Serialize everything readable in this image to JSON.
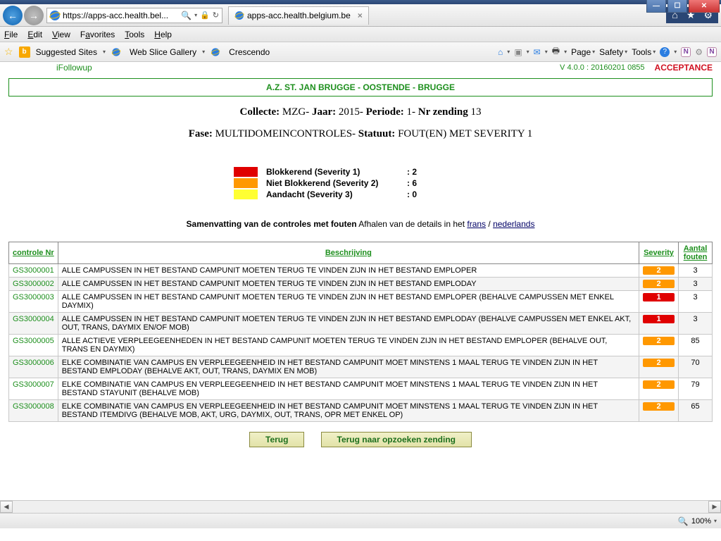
{
  "window": {
    "url": "https://apps-acc.health.bel...",
    "tab_title": "apps-acc.health.belgium.be"
  },
  "menus": {
    "file": "File",
    "edit": "Edit",
    "view": "View",
    "favorites": "Favorites",
    "tools": "Tools",
    "help": "Help"
  },
  "fav": {
    "suggested": "Suggested Sites",
    "webslice": "Web Slice Gallery",
    "crescendo": "Crescendo",
    "page": "Page",
    "safety": "Safety",
    "tools": "Tools"
  },
  "page": {
    "ifollow": "iFollowup",
    "version": "V 4.0.0 : 20160201 0855",
    "acceptance": "ACCEPTANCE",
    "banner": "A.Z. ST. JAN BRUGGE - OOSTENDE - BRUGGE",
    "meta": {
      "collecte_lbl": "Collecte:",
      "collecte_val": "MZG",
      "jaar_lbl": "Jaar:",
      "jaar_val": "2015",
      "periode_lbl": "Periode:",
      "periode_val": "1",
      "nr_lbl": "Nr zending",
      "nr_val": "13",
      "fase_lbl": "Fase:",
      "fase_val": "MULTIDOMEINCONTROLES",
      "statuut_lbl": "Statuut:",
      "statuut_val": "FOUT(EN) MET SEVERITY 1"
    },
    "legend": {
      "s1_label": "Blokkerend (Severity 1)",
      "s1_val": ": 2",
      "s2_label": "Niet Blokkerend (Severity 2)",
      "s2_val": ": 6",
      "s3_label": "Aandacht (Severity 3)",
      "s3_val": ": 0"
    },
    "summary": {
      "bold": "Samenvatting van de controles met fouten",
      "rest": "  Afhalen van de details in het ",
      "frans": "frans",
      "sep": " / ",
      "nl": "nederlands"
    },
    "headers": {
      "nr": "controle Nr",
      "beschr": "Beschrijving",
      "sev": "Severity",
      "aantal": "Aantal fouten"
    },
    "rows": [
      {
        "nr": "GS3000001",
        "desc": "ALLE CAMPUSSEN IN HET BESTAND CAMPUNIT MOETEN TERUG TE VINDEN ZIJN IN HET BESTAND EMPLOPER",
        "sev": 2,
        "fouten": 3
      },
      {
        "nr": "GS3000002",
        "desc": "ALLE CAMPUSSEN IN HET BESTAND CAMPUNIT MOETEN TERUG TE VINDEN ZIJN IN HET BESTAND EMPLODAY",
        "sev": 2,
        "fouten": 3
      },
      {
        "nr": "GS3000003",
        "desc": "ALLE CAMPUSSEN IN HET BESTAND CAMPUNIT MOETEN TERUG TE VINDEN ZIJN IN HET BESTAND EMPLOPER (BEHALVE CAMPUSSEN MET ENKEL DAYMIX)",
        "sev": 1,
        "fouten": 3
      },
      {
        "nr": "GS3000004",
        "desc": "ALLE CAMPUSSEN IN HET BESTAND CAMPUNIT MOETEN TERUG TE VINDEN ZIJN IN HET BESTAND EMPLODAY (BEHALVE CAMPUSSEN MET ENKEL AKT, OUT, TRANS, DAYMIX EN/OF MOB)",
        "sev": 1,
        "fouten": 3
      },
      {
        "nr": "GS3000005",
        "desc": "ALLE ACTIEVE VERPLEEGEENHEDEN IN HET BESTAND CAMPUNIT MOETEN TERUG TE VINDEN ZIJN IN HET BESTAND EMPLOPER (BEHALVE OUT, TRANS EN DAYMIX)",
        "sev": 2,
        "fouten": 85
      },
      {
        "nr": "GS3000006",
        "desc": "ELKE COMBINATIE VAN CAMPUS EN VERPLEEGEENHEID IN HET BESTAND CAMPUNIT MOET MINSTENS 1 MAAL TERUG TE VINDEN ZIJN IN HET BESTAND EMPLODAY (BEHALVE AKT, OUT, TRANS, DAYMIX EN MOB)",
        "sev": 2,
        "fouten": 70
      },
      {
        "nr": "GS3000007",
        "desc": "ELKE COMBINATIE VAN CAMPUS EN VERPLEEGEENHEID IN HET BESTAND CAMPUNIT MOET MINSTENS 1 MAAL TERUG TE VINDEN ZIJN IN HET BESTAND STAYUNIT (BEHALVE MOB)",
        "sev": 2,
        "fouten": 79
      },
      {
        "nr": "GS3000008",
        "desc": "ELKE COMBINATIE VAN CAMPUS EN VERPLEEGEENHEID IN HET BESTAND CAMPUNIT MOET MINSTENS 1 MAAL TERUG TE VINDEN ZIJN IN HET BESTAND ITEMDIVG (BEHALVE MOB, AKT, URG, DAYMIX, OUT, TRANS, OPR MET ENKEL OP)",
        "sev": 2,
        "fouten": 65
      }
    ],
    "buttons": {
      "terug": "Terug",
      "opzoeken": "Terug naar opzoeken zending"
    }
  },
  "status": {
    "zoom": "100%"
  }
}
